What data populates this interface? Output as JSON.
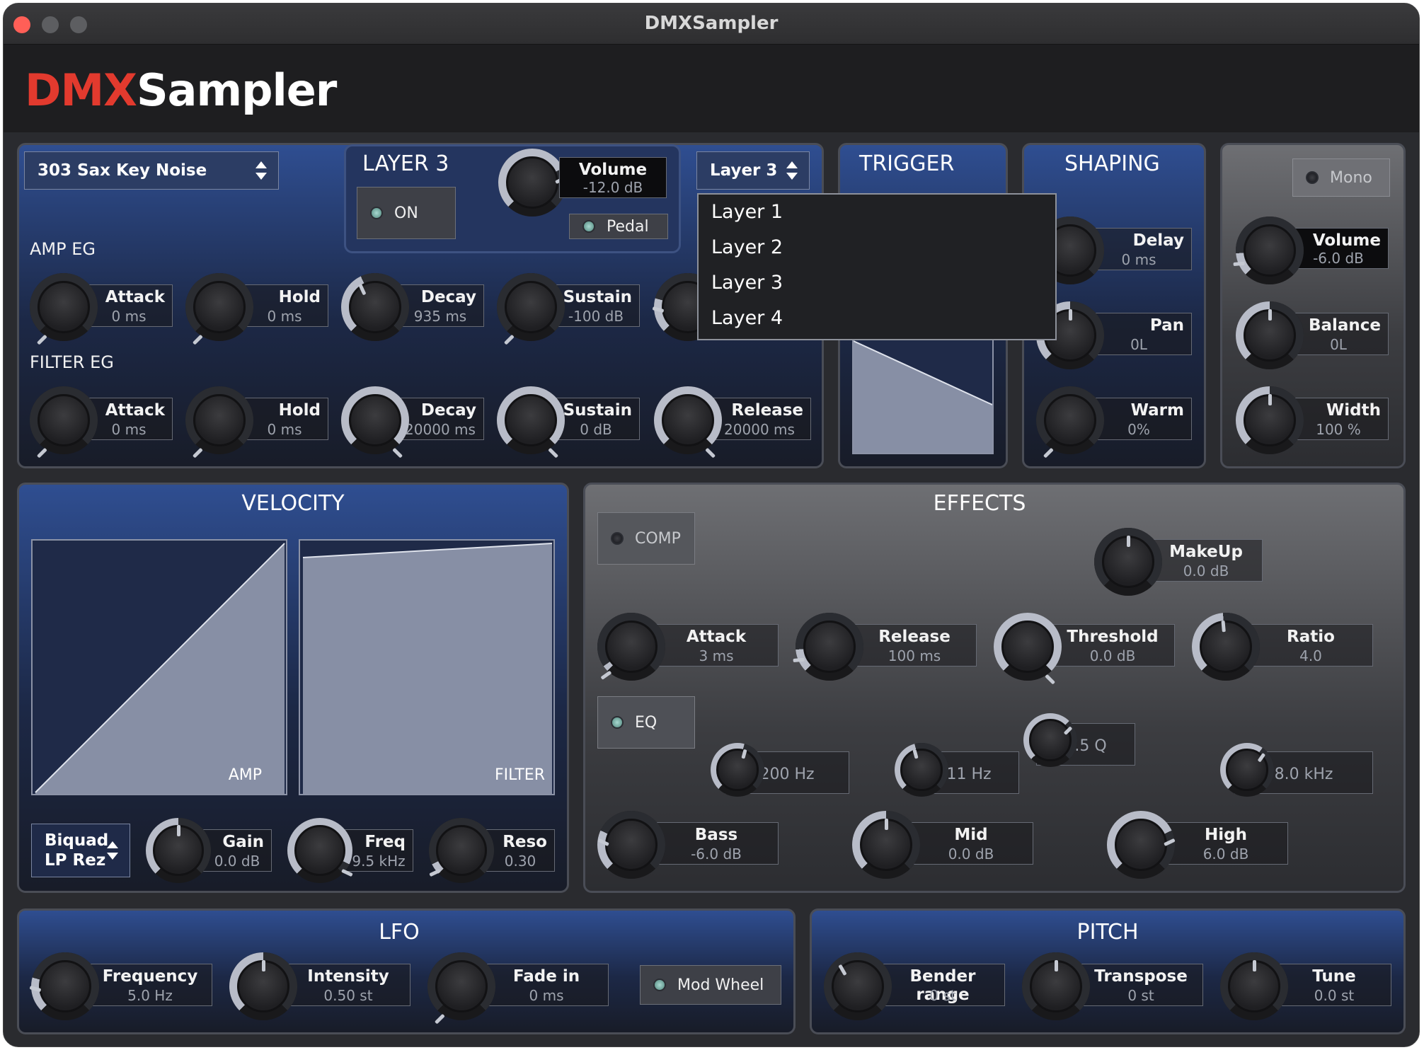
{
  "window": {
    "title": "DMXSampler"
  },
  "logo": {
    "prefix": "DMX",
    "suffix": "Sampler"
  },
  "preset": {
    "name": "303 Sax Key Noise"
  },
  "layer": {
    "title": "LAYER 3",
    "on_label": "ON",
    "pedal_label": "Pedal",
    "volume_label": "Volume",
    "volume_value": "-12.0 dB",
    "selector": "Layer 3"
  },
  "layer_menu": [
    "Layer 1",
    "Layer 2",
    "Layer 3",
    "Layer 4"
  ],
  "amp_eg": {
    "title": "AMP EG",
    "attack": {
      "label": "Attack",
      "value": "0 ms"
    },
    "hold": {
      "label": "Hold",
      "value": "0 ms"
    },
    "decay": {
      "label": "Decay",
      "value": "935 ms"
    },
    "sustain": {
      "label": "Sustain",
      "value": "-100 dB"
    }
  },
  "filter_eg": {
    "title": "FILTER EG",
    "attack": {
      "label": "Attack",
      "value": "0 ms"
    },
    "hold": {
      "label": "Hold",
      "value": "0 ms"
    },
    "decay": {
      "label": "Decay",
      "value": "20000 ms"
    },
    "sustain": {
      "label": "Sustain",
      "value": "0 dB"
    },
    "release": {
      "label": "Release",
      "value": "20000 ms"
    }
  },
  "trigger": {
    "title": "TRIGGER"
  },
  "shaping": {
    "title": "SHAPING",
    "delay": {
      "label": "Delay",
      "value": "0 ms"
    },
    "pan": {
      "label": "Pan",
      "value": "0L"
    },
    "warm": {
      "label": "Warm",
      "value": "0%"
    }
  },
  "output": {
    "mono_label": "Mono",
    "volume": {
      "label": "Volume",
      "value": "-6.0 dB"
    },
    "balance": {
      "label": "Balance",
      "value": "0L"
    },
    "width": {
      "label": "Width",
      "value": "100 %"
    }
  },
  "velocity": {
    "title": "VELOCITY",
    "amp_label": "AMP",
    "filter_label": "FILTER"
  },
  "filter": {
    "type_line1": "Biquad",
    "type_line2": "LP Rez",
    "gain": {
      "label": "Gain",
      "value": "0.0 dB"
    },
    "freq": {
      "label": "Freq",
      "value": "9.5 kHz"
    },
    "reso": {
      "label": "Reso",
      "value": "0.30"
    }
  },
  "effects": {
    "title": "EFFECTS",
    "comp_label": "COMP",
    "eq_label": "EQ",
    "makeup": {
      "label": "MakeUp",
      "value": "0.0 dB"
    },
    "attack": {
      "label": "Attack",
      "value": "3 ms"
    },
    "release": {
      "label": "Release",
      "value": "100 ms"
    },
    "threshold": {
      "label": "Threshold",
      "value": "0.0 dB"
    },
    "ratio": {
      "label": "Ratio",
      "value": "4.0"
    },
    "eq_f1": "200 Hz",
    "eq_f2": "111 Hz",
    "eq_q": "1.5 Q",
    "eq_f3": "8.0 kHz",
    "bass": {
      "label": "Bass",
      "value": "-6.0 dB"
    },
    "mid": {
      "label": "Mid",
      "value": "0.0 dB"
    },
    "high": {
      "label": "High",
      "value": "6.0 dB"
    }
  },
  "lfo": {
    "title": "LFO",
    "frequency": {
      "label": "Frequency",
      "value": "5.0 Hz"
    },
    "intensity": {
      "label": "Intensity",
      "value": "0.50 st"
    },
    "fade_in": {
      "label": "Fade in",
      "value": "0 ms"
    },
    "modwheel_label": "Mod Wheel"
  },
  "pitch": {
    "title": "PITCH",
    "bender": {
      "label": "Bender range",
      "value": "0 st"
    },
    "transpose": {
      "label": "Transpose",
      "value": "0 st"
    },
    "tune": {
      "label": "Tune",
      "value": "0.0 st"
    }
  },
  "colors": {
    "panel_blue": "#2f4e91",
    "accent_red": "#e23a2e",
    "led_on": "#8cc4bb"
  }
}
